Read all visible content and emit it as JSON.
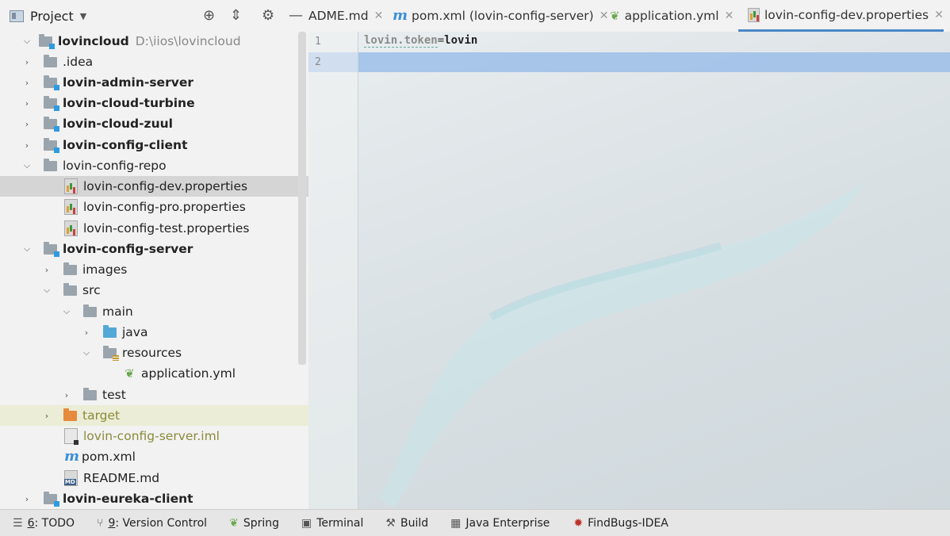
{
  "project_panel": {
    "title": "Project",
    "tree": [
      {
        "label": "lovincloud",
        "path": "D:\\iios\\lovincloud"
      },
      {
        "label": ".idea"
      },
      {
        "label": "lovin-admin-server"
      },
      {
        "label": "lovin-cloud-turbine"
      },
      {
        "label": "lovin-cloud-zuul"
      },
      {
        "label": "lovin-config-client"
      },
      {
        "label": "lovin-config-repo"
      },
      {
        "label": "lovin-config-dev.properties"
      },
      {
        "label": "lovin-config-pro.properties"
      },
      {
        "label": "lovin-config-test.properties"
      },
      {
        "label": "lovin-config-server"
      },
      {
        "label": "images"
      },
      {
        "label": "src"
      },
      {
        "label": "main"
      },
      {
        "label": "java"
      },
      {
        "label": "resources"
      },
      {
        "label": "application.yml"
      },
      {
        "label": "test"
      },
      {
        "label": "target"
      },
      {
        "label": "lovin-config-server.iml"
      },
      {
        "label": "pom.xml"
      },
      {
        "label": "README.md"
      },
      {
        "label": "lovin-eureka-client"
      }
    ]
  },
  "tabs": [
    {
      "label": "ADME.md"
    },
    {
      "label": "pom.xml (lovin-config-server)"
    },
    {
      "label": "application.yml"
    },
    {
      "label": "lovin-config-dev.properties",
      "active": true
    }
  ],
  "editor": {
    "lines": [
      {
        "num": "1",
        "key": "lovin.token",
        "sep": "=",
        "value": "lovin"
      },
      {
        "num": "2"
      }
    ]
  },
  "bottom_bar": [
    {
      "num": "6",
      "label": ": TODO",
      "icon": "list-icon"
    },
    {
      "num": "9",
      "label": ": Version Control",
      "icon": "branch-icon"
    },
    {
      "label": "Spring",
      "icon": "spring-leaf-icon"
    },
    {
      "label": "Terminal",
      "icon": "terminal-icon"
    },
    {
      "label": "Build",
      "icon": "hammer-icon"
    },
    {
      "label": "Java Enterprise",
      "icon": "java-ee-icon"
    },
    {
      "label": "FindBugs-IDEA",
      "icon": "bug-icon"
    }
  ],
  "colors": {
    "accent": "#4a86c8",
    "selection": "#93b8e8",
    "module_marker": "#2f9be0"
  }
}
